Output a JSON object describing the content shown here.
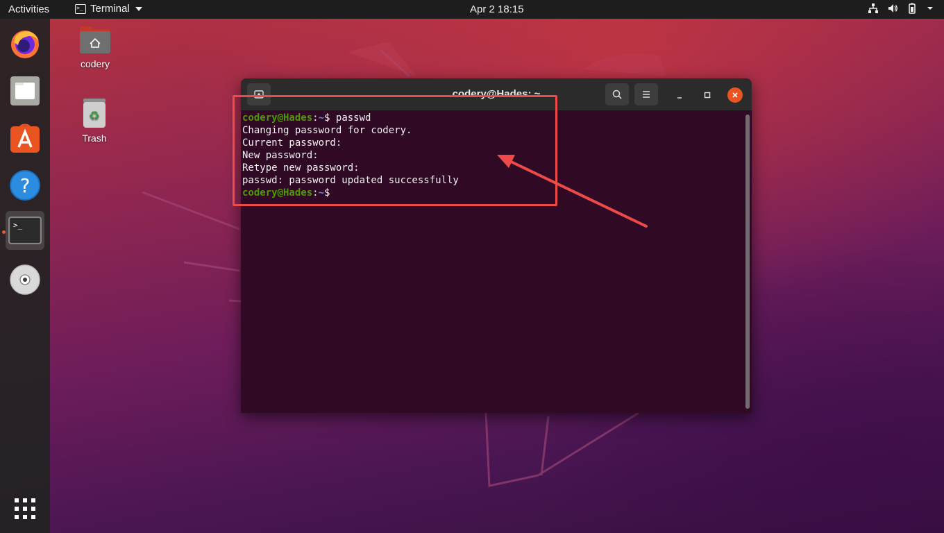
{
  "topbar": {
    "activities": "Activities",
    "app_name": "Terminal",
    "clock": "Apr 2  18:15"
  },
  "dock": {
    "items": [
      {
        "name": "Firefox",
        "icon": "firefox-icon"
      },
      {
        "name": "Files",
        "icon": "files-icon"
      },
      {
        "name": "Ubuntu Software",
        "icon": "software-icon"
      },
      {
        "name": "Help",
        "icon": "help-icon"
      },
      {
        "name": "Terminal",
        "icon": "terminal-icon",
        "active": true
      },
      {
        "name": "Disc",
        "icon": "disc-icon"
      }
    ],
    "apps_grid_icon": "apps-grid-icon"
  },
  "desktop": {
    "home_label": "codery",
    "trash_label": "Trash"
  },
  "terminal": {
    "title": "codery@Hades: ~",
    "lines": [
      {
        "user": "codery@Hades",
        "path": "~",
        "cmd": "passwd"
      },
      {
        "text": "Changing password for codery."
      },
      {
        "text": "Current password:"
      },
      {
        "text": "New password:"
      },
      {
        "text": "Retype new password:"
      },
      {
        "text": "passwd: password updated successfully"
      },
      {
        "user": "codery@Hades",
        "path": "~",
        "cmd": ""
      }
    ]
  },
  "colors": {
    "annotation": "#ef4a4a",
    "terminal_bg": "#300a24",
    "prompt_user": "#4e9a06",
    "prompt_path": "#5d8fd6",
    "close_button": "#e95420"
  }
}
